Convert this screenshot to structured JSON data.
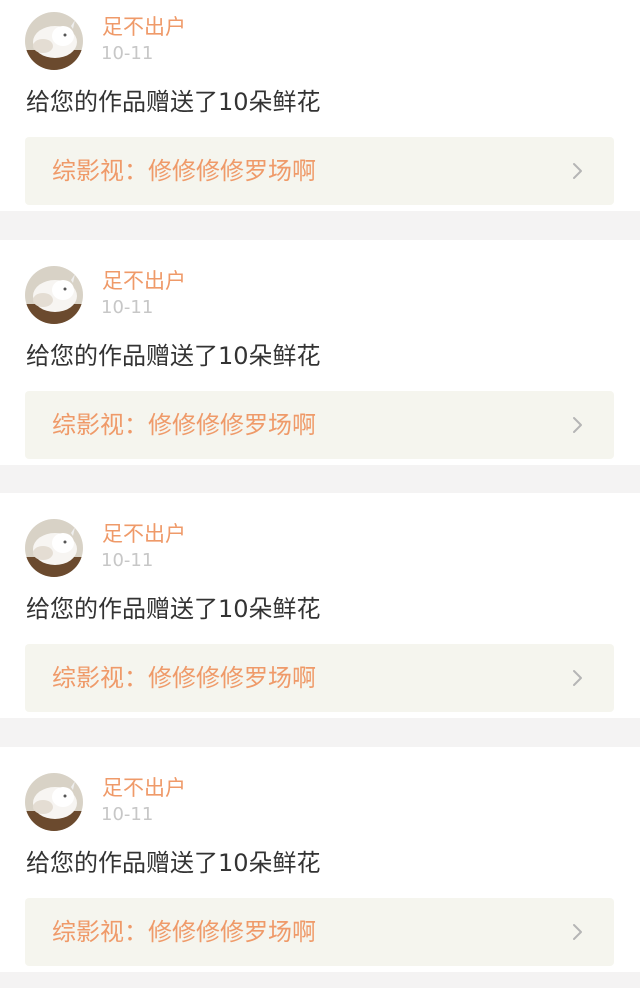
{
  "notifications": [
    {
      "username": "足不出户",
      "date": "10-11",
      "message": "给您的作品赠送了10朵鲜花",
      "work_title": "综影视：修修修修罗场啊"
    },
    {
      "username": "足不出户",
      "date": "10-11",
      "message": "给您的作品赠送了10朵鲜花",
      "work_title": "综影视：修修修修罗场啊"
    },
    {
      "username": "足不出户",
      "date": "10-11",
      "message": "给您的作品赠送了10朵鲜花",
      "work_title": "综影视：修修修修罗场啊"
    },
    {
      "username": "足不出户",
      "date": "10-11",
      "message": "给您的作品赠送了10朵鲜花",
      "work_title": "综影视：修修修修罗场啊"
    }
  ],
  "icons": {
    "avatar": "cat-avatar-icon",
    "link_arrow": "chevron-right-icon"
  },
  "colors": {
    "accent": "#ef9a69",
    "tab_indicator": "#f06aa0",
    "link_background": "#f5f5ee",
    "page_background": "#f4f3f3"
  }
}
